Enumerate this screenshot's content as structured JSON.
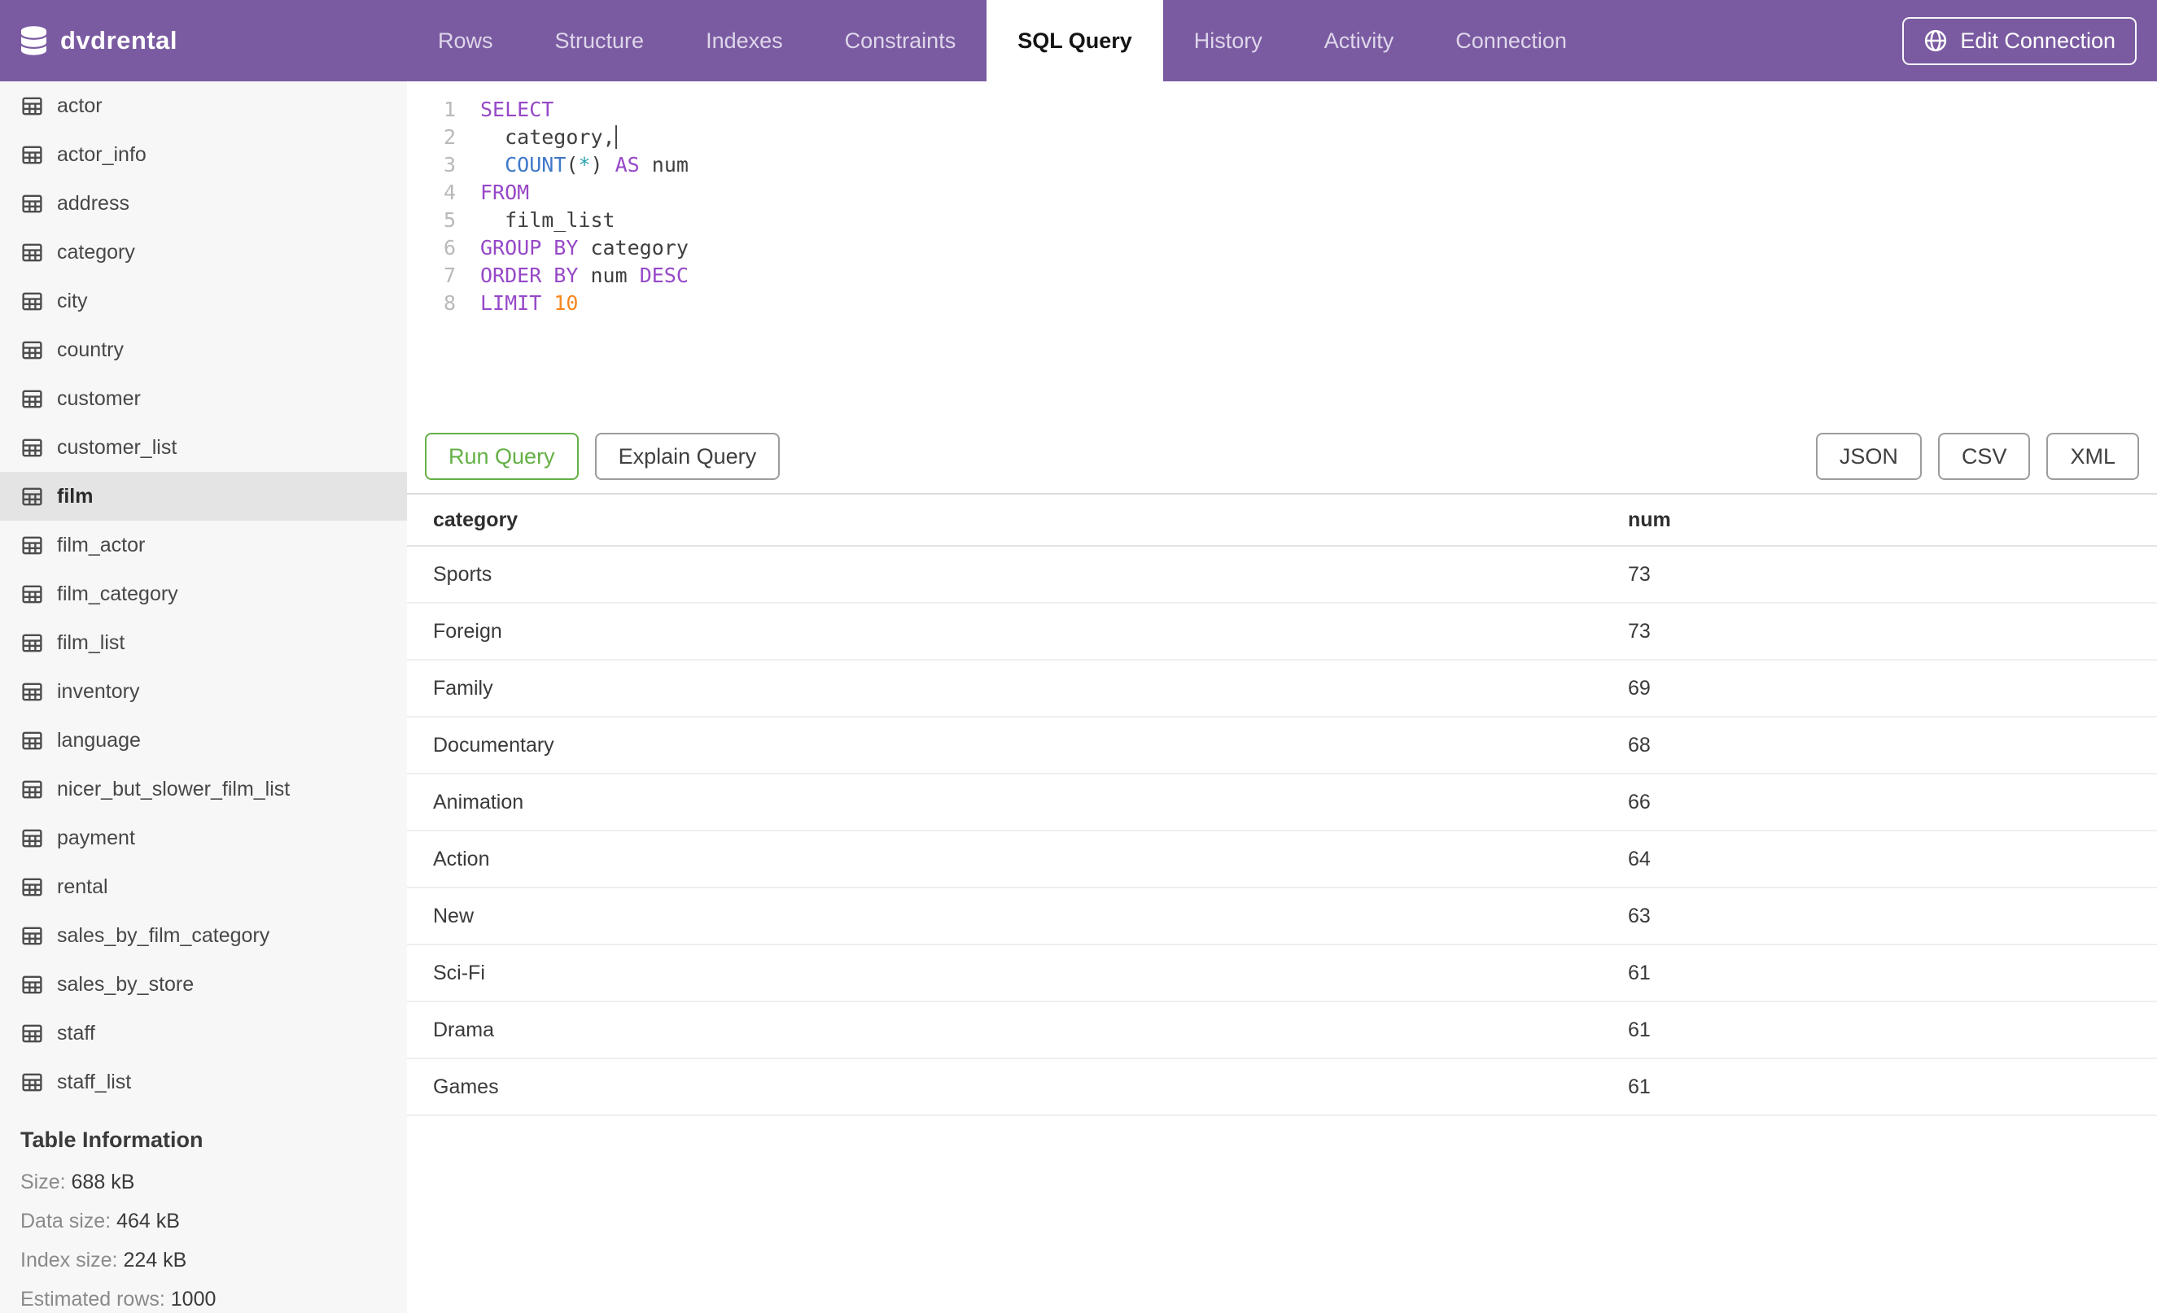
{
  "colors": {
    "topbar_purple": "#7a5ba1",
    "active_tab_bg": "#ffffff",
    "run_button_green": "#64b046",
    "sidebar_bg": "#f7f7f7",
    "selected_row_gray": "#e4e4e4",
    "syntax": {
      "keyword": "#9648c8",
      "builtin": "#4078c8",
      "operator": "#2ba3ab",
      "number": "#f5871f",
      "text": "#3f3f3f",
      "line_number": "#b9b9b9"
    }
  },
  "header": {
    "app_title": "dvdrental",
    "tabs": [
      {
        "label": "Rows",
        "active": false
      },
      {
        "label": "Structure",
        "active": false
      },
      {
        "label": "Indexes",
        "active": false
      },
      {
        "label": "Constraints",
        "active": false
      },
      {
        "label": "SQL Query",
        "active": true
      },
      {
        "label": "History",
        "active": false
      },
      {
        "label": "Activity",
        "active": false
      },
      {
        "label": "Connection",
        "active": false
      }
    ],
    "edit_connection_label": "Edit Connection"
  },
  "sidebar": {
    "selected_table": "film",
    "tables": [
      "actor",
      "actor_info",
      "address",
      "category",
      "city",
      "country",
      "customer",
      "customer_list",
      "film",
      "film_actor",
      "film_category",
      "film_list",
      "inventory",
      "language",
      "nicer_but_slower_film_list",
      "payment",
      "rental",
      "sales_by_film_category",
      "sales_by_store",
      "staff",
      "staff_list"
    ],
    "table_information": {
      "heading": "Table Information",
      "rows": [
        {
          "label": "Size:",
          "value": "688 kB"
        },
        {
          "label": "Data size:",
          "value": "464 kB"
        },
        {
          "label": "Index size:",
          "value": "224 kB"
        },
        {
          "label": "Estimated rows:",
          "value": "1000"
        }
      ]
    }
  },
  "editor": {
    "lines": [
      {
        "number": "1",
        "segments": [
          {
            "text": "SELECT",
            "type": "keyword"
          }
        ]
      },
      {
        "number": "2",
        "segments": [
          {
            "text": "  category,",
            "type": "text"
          },
          {
            "type": "cursor"
          }
        ]
      },
      {
        "number": "3",
        "segments": [
          {
            "text": "  ",
            "type": "text"
          },
          {
            "text": "COUNT",
            "type": "builtin"
          },
          {
            "text": "(",
            "type": "text"
          },
          {
            "text": "*",
            "type": "operator"
          },
          {
            "text": ") ",
            "type": "text"
          },
          {
            "text": "AS",
            "type": "keyword"
          },
          {
            "text": " num",
            "type": "text"
          }
        ]
      },
      {
        "number": "4",
        "segments": [
          {
            "text": "FROM",
            "type": "keyword"
          }
        ]
      },
      {
        "number": "5",
        "segments": [
          {
            "text": "  film_list",
            "type": "text"
          }
        ]
      },
      {
        "number": "6",
        "segments": [
          {
            "text": "GROUP BY",
            "type": "keyword"
          },
          {
            "text": " category",
            "type": "text"
          }
        ]
      },
      {
        "number": "7",
        "segments": [
          {
            "text": "ORDER BY",
            "type": "keyword"
          },
          {
            "text": " num ",
            "type": "text"
          },
          {
            "text": "DESC",
            "type": "keyword"
          }
        ]
      },
      {
        "number": "8",
        "segments": [
          {
            "text": "LIMIT",
            "type": "keyword"
          },
          {
            "text": " ",
            "type": "text"
          },
          {
            "text": "10",
            "type": "number"
          }
        ]
      }
    ]
  },
  "actions": {
    "run_label": "Run Query",
    "explain_label": "Explain Query",
    "export_labels": [
      "JSON",
      "CSV",
      "XML"
    ]
  },
  "results": {
    "columns": [
      "category",
      "num"
    ],
    "rows": [
      [
        "Sports",
        "73"
      ],
      [
        "Foreign",
        "73"
      ],
      [
        "Family",
        "69"
      ],
      [
        "Documentary",
        "68"
      ],
      [
        "Animation",
        "66"
      ],
      [
        "Action",
        "64"
      ],
      [
        "New",
        "63"
      ],
      [
        "Sci-Fi",
        "61"
      ],
      [
        "Drama",
        "61"
      ],
      [
        "Games",
        "61"
      ]
    ]
  }
}
